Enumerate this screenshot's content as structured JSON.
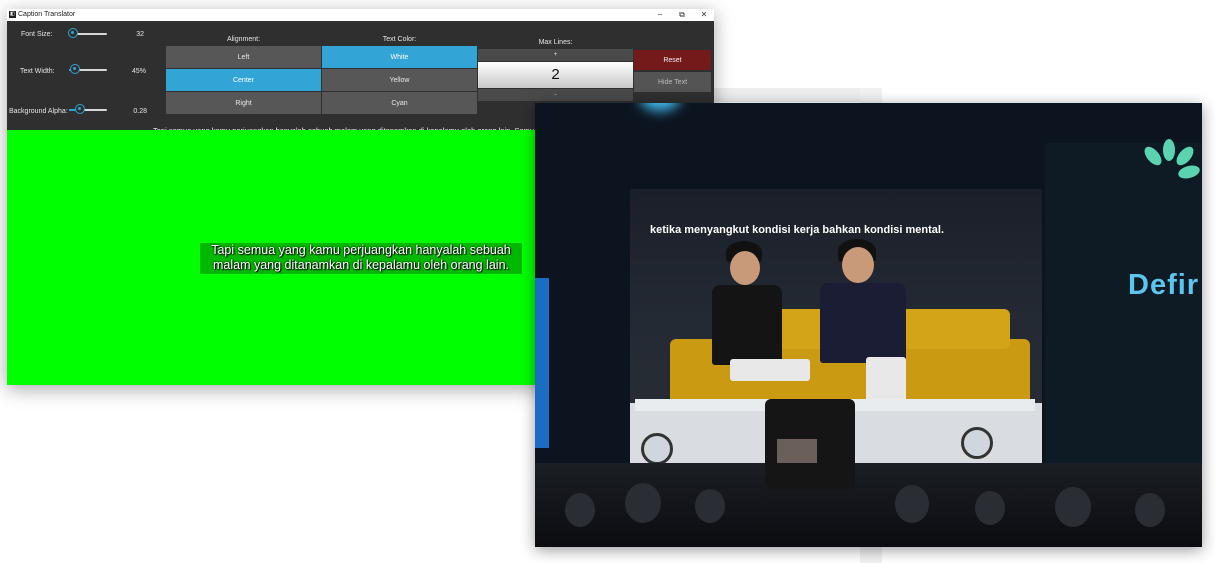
{
  "window": {
    "title": "Caption Translator",
    "icon_name": "app-icon"
  },
  "controls": {
    "font_size": {
      "label": "Font Size:",
      "value": "32",
      "fraction": 0.0
    },
    "text_width": {
      "label": "Text Width:",
      "value": "45%",
      "fraction": 0.15
    },
    "background_alpha": {
      "label": "Background Alpha:",
      "value": "0.28",
      "fraction": 0.28
    }
  },
  "alignment": {
    "header": "Alignment:",
    "options": [
      "Left",
      "Center",
      "Right"
    ],
    "selected": "Center"
  },
  "text_color": {
    "header": "Text Color:",
    "options": [
      "White",
      "Yellow",
      "Cyan"
    ],
    "selected": "White"
  },
  "max_lines": {
    "header": "Max Lines:",
    "increment": "+",
    "value": "2",
    "decrement": "-"
  },
  "actions": {
    "reset": "Reset",
    "hide_text": "Hide Text"
  },
  "preview_text": "Tapi semua yang kamu perjuangkan hanyalah sebuah malam yang ditanamkan di kepalamu oleh orang lain. Semua orang",
  "caption": {
    "line1": "Tapi semua yang kamu perjuangkan hanyalah sebuah",
    "line2": "malam yang ditanamkan di kepalamu oleh orang lain."
  },
  "video": {
    "screen_caption": "ketika menyangkut kondisi kerja bahkan kondisi mental.",
    "brand_text": "Defir"
  },
  "colors": {
    "accent": "#33a4d6",
    "reset": "#741a1a",
    "chroma": "#00ff00"
  }
}
